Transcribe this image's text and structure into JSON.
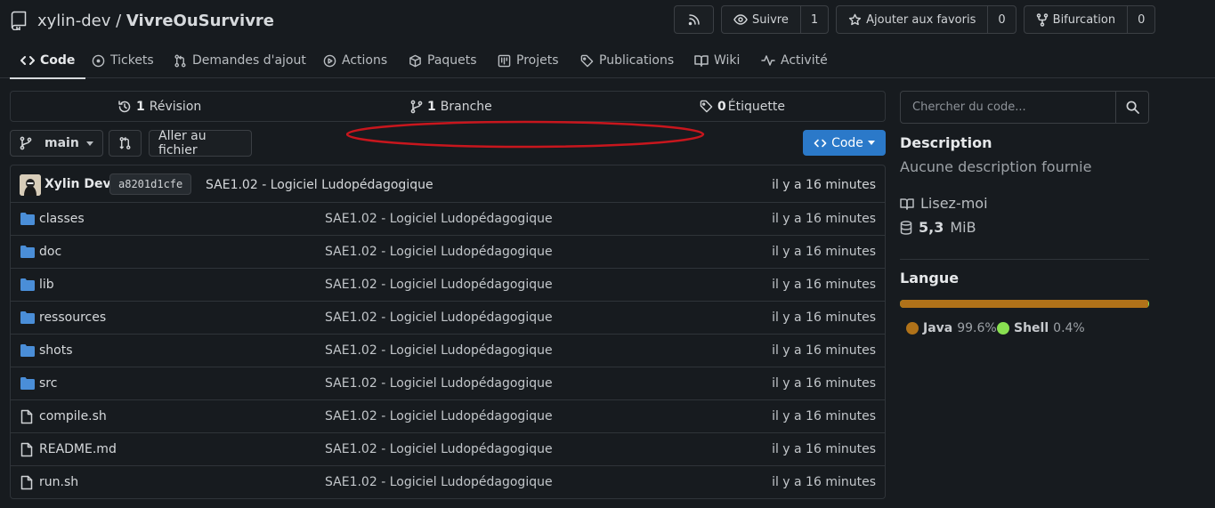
{
  "header": {
    "owner": "xylin-dev",
    "separator": "/",
    "repo": "VivreOuSurvivre",
    "watch_label": "Suivre",
    "watch_count": "1",
    "star_label": "Ajouter aux favoris",
    "star_count": "0",
    "fork_label": "Bifurcation",
    "fork_count": "0"
  },
  "tabs": [
    {
      "label": "Code",
      "icon": "code-icon",
      "active": true
    },
    {
      "label": "Tickets",
      "icon": "issue-icon"
    },
    {
      "label": "Demandes d'ajout",
      "icon": "pull-request-icon"
    },
    {
      "label": "Actions",
      "icon": "play-icon"
    },
    {
      "label": "Paquets",
      "icon": "package-icon"
    },
    {
      "label": "Projets",
      "icon": "project-icon"
    },
    {
      "label": "Publications",
      "icon": "tag-icon"
    },
    {
      "label": "Wiki",
      "icon": "book-icon"
    },
    {
      "label": "Activité",
      "icon": "pulse-icon"
    }
  ],
  "stats": {
    "commits_count": "1",
    "commits_label": "Révision",
    "branches_count": "1",
    "branches_label": "Branche",
    "tags_count": "0",
    "tags_label": "Étiquette"
  },
  "branch_bar": {
    "branch": "main",
    "goto_file": "Aller au fichier",
    "code_button": "Code"
  },
  "commit": {
    "author": "Xylin Dev",
    "sha": "a8201d1cfe",
    "message": "SAE1.02 - Logiciel Ludopédagogique",
    "time": "il y a 16 minutes"
  },
  "files": [
    {
      "name": "classes",
      "type": "folder",
      "message": "SAE1.02 - Logiciel Ludopédagogique",
      "time": "il y a 16 minutes"
    },
    {
      "name": "doc",
      "type": "folder",
      "message": "SAE1.02 - Logiciel Ludopédagogique",
      "time": "il y a 16 minutes"
    },
    {
      "name": "lib",
      "type": "folder",
      "message": "SAE1.02 - Logiciel Ludopédagogique",
      "time": "il y a 16 minutes"
    },
    {
      "name": "ressources",
      "type": "folder",
      "message": "SAE1.02 - Logiciel Ludopédagogique",
      "time": "il y a 16 minutes"
    },
    {
      "name": "shots",
      "type": "folder",
      "message": "SAE1.02 - Logiciel Ludopédagogique",
      "time": "il y a 16 minutes"
    },
    {
      "name": "src",
      "type": "folder",
      "message": "SAE1.02 - Logiciel Ludopédagogique",
      "time": "il y a 16 minutes"
    },
    {
      "name": "compile.sh",
      "type": "file",
      "message": "SAE1.02 - Logiciel Ludopédagogique",
      "time": "il y a 16 minutes"
    },
    {
      "name": "README.md",
      "type": "file",
      "message": "SAE1.02 - Logiciel Ludopédagogique",
      "time": "il y a 16 minutes"
    },
    {
      "name": "run.sh",
      "type": "file",
      "message": "SAE1.02 - Logiciel Ludopédagogique",
      "time": "il y a 16 minutes"
    }
  ],
  "sidebar": {
    "search_placeholder": "Chercher du code...",
    "description_title": "Description",
    "description_text": "Aucune description fournie",
    "readme_label": "Lisez-moi",
    "size_value": "5,3",
    "size_unit": "MiB",
    "language_title": "Langue",
    "languages": [
      {
        "name": "Java",
        "percent": "99.6%",
        "fraction": 0.996,
        "color": "#b07219"
      },
      {
        "name": "Shell",
        "percent": "0.4%",
        "fraction": 0.004,
        "color": "#89e051"
      }
    ]
  },
  "colors": {
    "accent_button": "#2b79c9",
    "annotation_ellipse": "#c8161d",
    "folder": "#4a8ed8"
  }
}
